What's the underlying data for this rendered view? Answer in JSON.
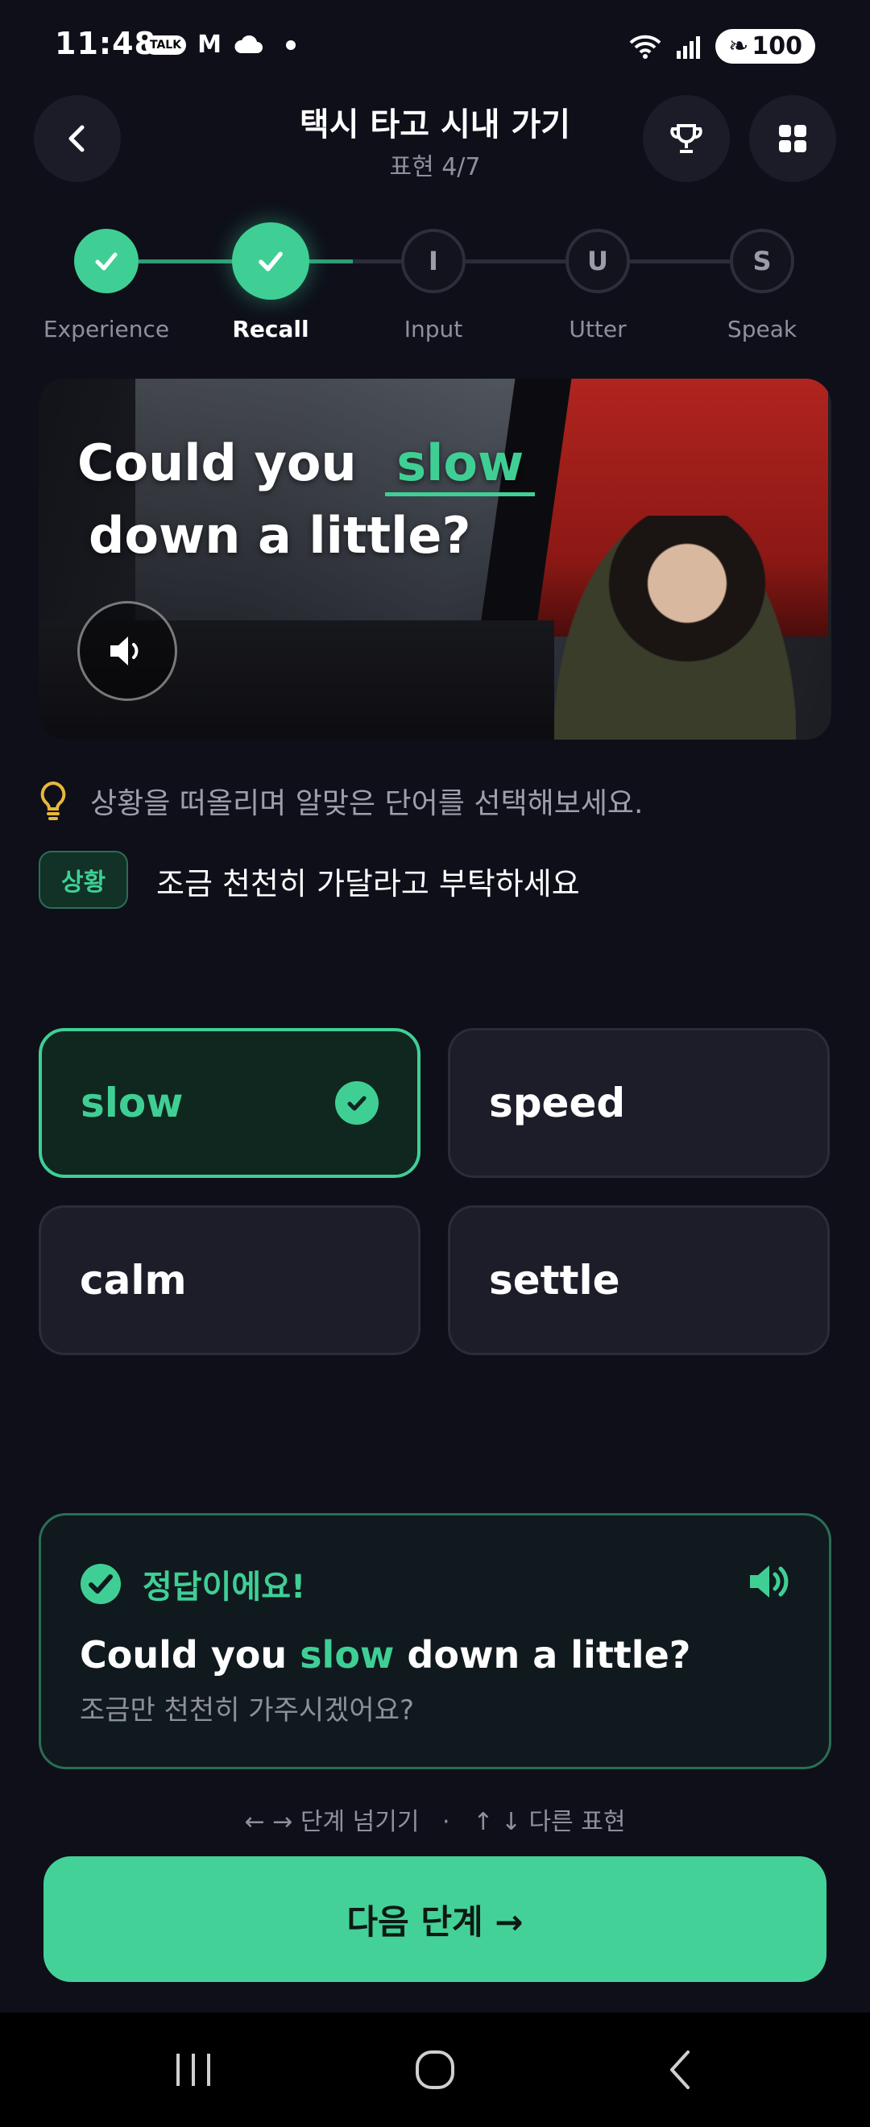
{
  "status_bar": {
    "time": "11:48",
    "battery": "100",
    "notification_icons": [
      "talk-icon",
      "gmail-icon",
      "cloud-icon",
      "dot-icon"
    ]
  },
  "header": {
    "title": "택시 타고 시내 가기",
    "subtitle": "표현 4/7"
  },
  "steps": [
    {
      "label": "Experience",
      "letter": "",
      "state": "done"
    },
    {
      "label": "Recall",
      "letter": "",
      "state": "active"
    },
    {
      "label": "Input",
      "letter": "I",
      "state": "pending"
    },
    {
      "label": "Utter",
      "letter": "U",
      "state": "pending"
    },
    {
      "label": "Speak",
      "letter": "S",
      "state": "pending"
    }
  ],
  "scene": {
    "sentence_before": "Could you",
    "blank_word": "slow",
    "sentence_after": "down a little?"
  },
  "hint": {
    "text": "상황을 떠올리며 알맞은 단어를 선택해보세요.",
    "context_badge": "상황",
    "context_text": "조금 천천히 가달라고 부탁하세요"
  },
  "options": [
    {
      "label": "slow",
      "selected": true
    },
    {
      "label": "speed",
      "selected": false
    },
    {
      "label": "calm",
      "selected": false
    },
    {
      "label": "settle",
      "selected": false
    }
  ],
  "feedback": {
    "title": "정답이에요!",
    "sentence_before": "Could you ",
    "sentence_highlight": "slow",
    "sentence_after": " down a little?",
    "translation": "조금만 천천히 가주시겠어요?"
  },
  "shortcut_hint": "← → 단계 넘기기   ·   ↑ ↓ 다른 표현",
  "next_button": "다음 단계 →",
  "colors": {
    "accent": "#3fcf95",
    "background": "#0e0f19",
    "card": "#1c1d29"
  }
}
